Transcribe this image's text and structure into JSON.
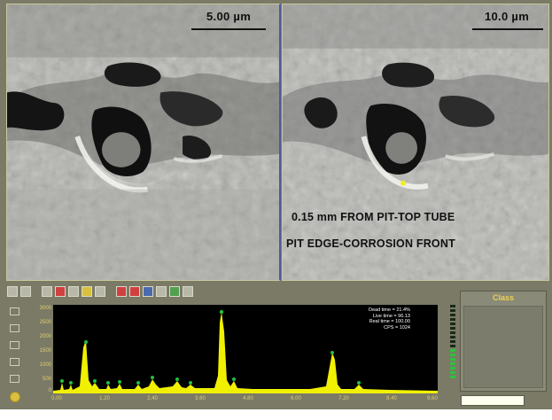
{
  "left_image": {
    "scale_label": "5.00 µm"
  },
  "right_image": {
    "scale_label": "10.0 µm",
    "caption_line1": "0.15 mm FROM PIT-TOP TUBE",
    "caption_line2": "PIT EDGE-CORROSION FRONT"
  },
  "spectrum": {
    "y_ticks": [
      "3000",
      "2500",
      "2000",
      "1500",
      "1000",
      "500",
      "0"
    ],
    "x_ticks": [
      "0.00",
      "1.20",
      "2.40",
      "3.60",
      "4.80",
      "6.00",
      "7.20",
      "8.40",
      "9.60"
    ],
    "stats": [
      "Dead time = 21.4%",
      "Live time = 96.13",
      "Real time = 100.00",
      "CPS = 1024"
    ]
  },
  "class_panel": {
    "title": "Class"
  },
  "colors": {
    "frame": "#7a7a66",
    "peak": "#f0f000",
    "class_title": "#f0d050",
    "marker": "#20c040"
  }
}
